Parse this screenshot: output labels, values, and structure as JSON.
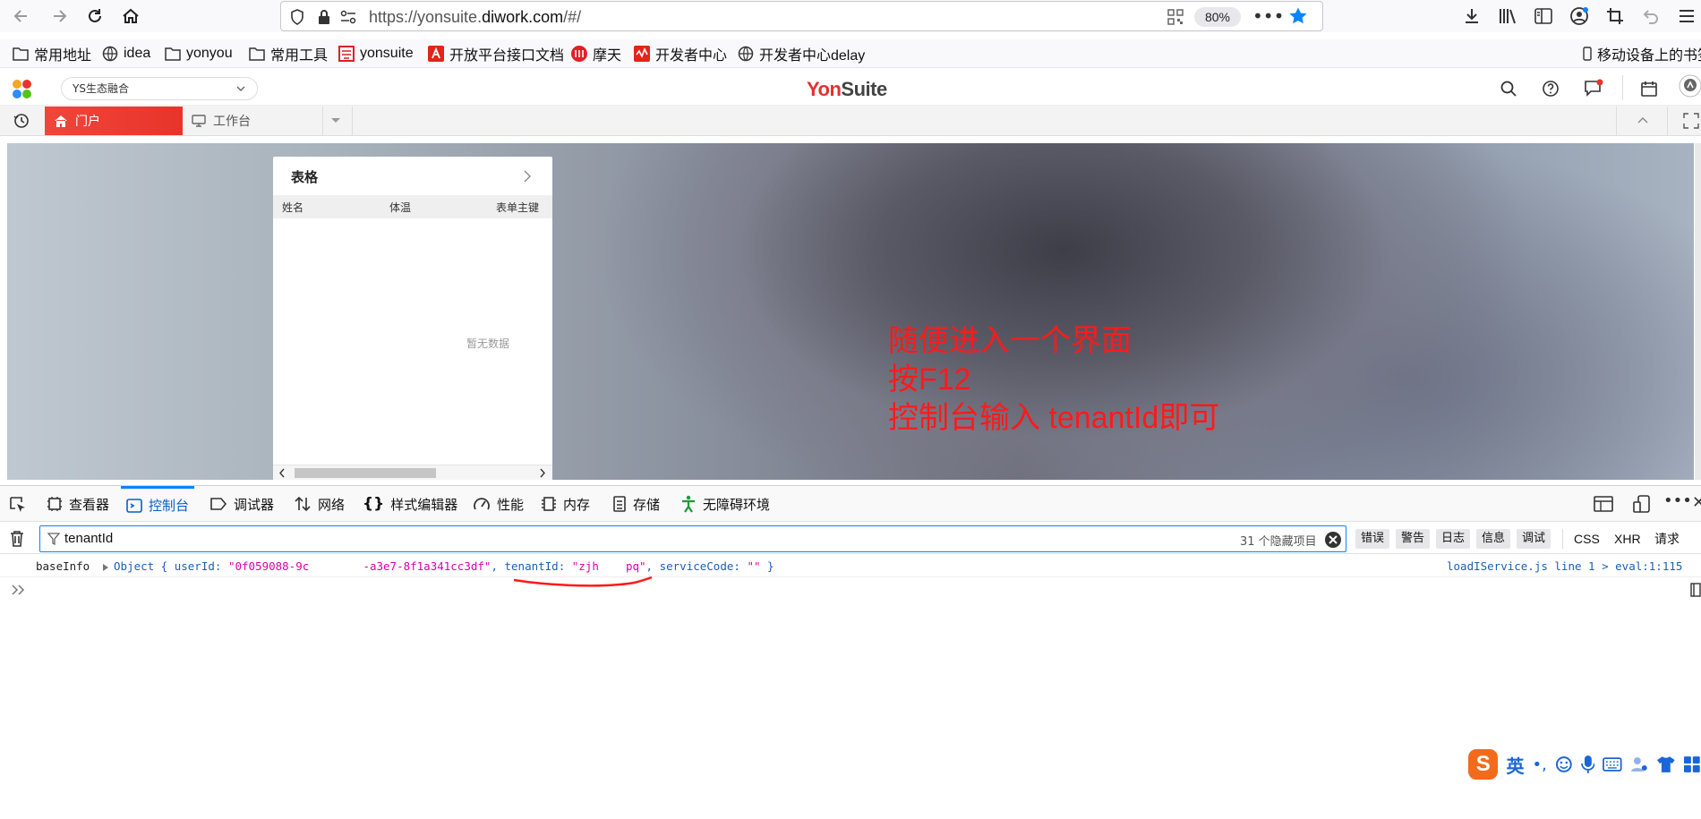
{
  "browser": {
    "url_prefix": "https://yonsuite.",
    "url_domain": "diwork.com",
    "url_suffix": "/#/",
    "zoom": "80%"
  },
  "bookmarks": [
    {
      "label": "常用地址",
      "icon": "folder-icon"
    },
    {
      "label": "idea",
      "icon": "globe-icon"
    },
    {
      "label": "yonyou",
      "icon": "folder-icon"
    },
    {
      "label": "常用工具",
      "icon": "folder-icon"
    },
    {
      "label": "yonsuite",
      "icon": "yonsuite-icon"
    },
    {
      "label": "开放平台接口文档",
      "icon": "acrobat-icon"
    },
    {
      "label": "摩天",
      "icon": "motian-icon"
    },
    {
      "label": "开发者中心",
      "icon": "devcenter-icon"
    },
    {
      "label": "开发者中心delay",
      "icon": "globe-icon"
    }
  ],
  "bookmarks_right": "移动设备上的书签",
  "app": {
    "org_select": "YS生态融合",
    "brand_yon": "Yon",
    "brand_suite": "Suite",
    "tabs": {
      "portal": "门户",
      "workbench": "工作台"
    }
  },
  "content": {
    "card": {
      "title": "表格",
      "columns": [
        "姓名",
        "体温",
        "表单主键"
      ],
      "empty_text": "暂无数据"
    },
    "annotation": [
      "随便进入一个界面",
      "按F12",
      "控制台输入 tenantId即可"
    ]
  },
  "devtools": {
    "tabs": [
      "查看器",
      "控制台",
      "调试器",
      "网络",
      "样式编辑器",
      "性能",
      "内存",
      "存储",
      "无障碍环境"
    ],
    "active_tab": "控制台",
    "filter_value": "tenantId",
    "hidden_count": "31 个隐藏项目",
    "levels": [
      "错误",
      "警告",
      "日志",
      "信息",
      "调试"
    ],
    "types": [
      "CSS",
      "XHR",
      "请求"
    ],
    "log": {
      "label": "baseInfo",
      "object_prefix": "Object { userId: ",
      "userId": "\"0f059088-9c        -a3e7-8f1a341cc3df\"",
      "mid": ", tenantId: ",
      "tenantId": "\"zjh    pq\"",
      "mid2": ", serviceCode: ",
      "serviceCode": "\"\"",
      "object_suffix": " }",
      "source": "loadIService.js line 1 > eval:1:115"
    },
    "colors": {
      "accent": "#0a84ff",
      "string": "#dd00a9",
      "object": "#1c5fb5",
      "annotation": "#ff1a1a"
    }
  },
  "ime": {
    "lang": "英"
  }
}
